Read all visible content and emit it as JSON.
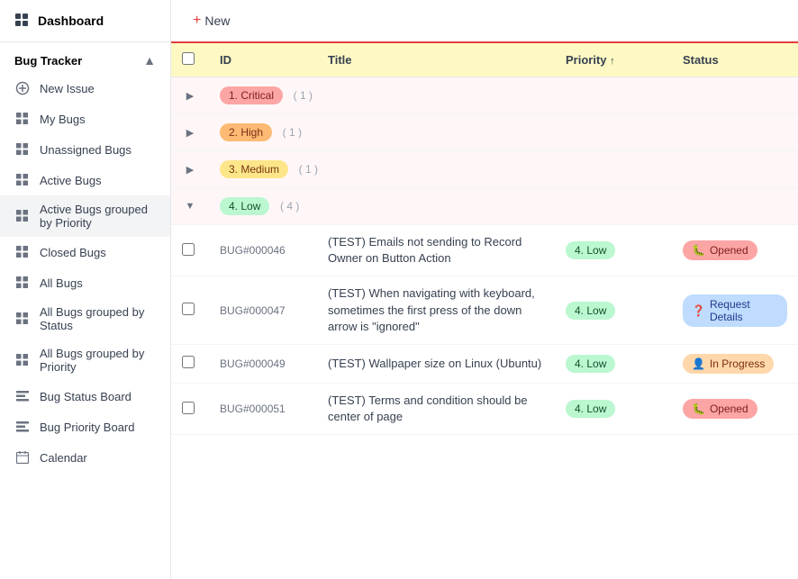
{
  "sidebar": {
    "dashboard_label": "Dashboard",
    "section_label": "Bug Tracker",
    "items": [
      {
        "id": "new-issue",
        "label": "New Issue",
        "icon": "circle-plus",
        "active": false
      },
      {
        "id": "my-bugs",
        "label": "My Bugs",
        "icon": "grid",
        "active": false
      },
      {
        "id": "unassigned-bugs",
        "label": "Unassigned Bugs",
        "icon": "grid",
        "active": false
      },
      {
        "id": "active-bugs",
        "label": "Active Bugs",
        "icon": "grid",
        "active": false
      },
      {
        "id": "active-bugs-grouped-priority",
        "label": "Active Bugs grouped by Priority",
        "icon": "grid",
        "active": true
      },
      {
        "id": "closed-bugs",
        "label": "Closed Bugs",
        "icon": "grid",
        "active": false
      },
      {
        "id": "all-bugs",
        "label": "All Bugs",
        "icon": "grid",
        "active": false
      },
      {
        "id": "all-bugs-grouped-status",
        "label": "All Bugs grouped by Status",
        "icon": "grid",
        "active": false
      },
      {
        "id": "all-bugs-grouped-priority",
        "label": "All Bugs grouped by Priority",
        "icon": "grid",
        "active": false
      },
      {
        "id": "bug-status-board",
        "label": "Bug Status Board",
        "icon": "bars",
        "active": false
      },
      {
        "id": "bug-priority-board",
        "label": "Bug Priority Board",
        "icon": "bars",
        "active": false
      },
      {
        "id": "calendar",
        "label": "Calendar",
        "icon": "cal",
        "active": false
      }
    ]
  },
  "toolbar": {
    "new_label": "New"
  },
  "table": {
    "columns": [
      "",
      "ID",
      "Title",
      "Priority ↑",
      "Status"
    ],
    "groups": [
      {
        "id": "critical",
        "priority_label": "1. Critical",
        "priority_class": "priority-critical",
        "count": "( 1 )",
        "expanded": false,
        "rows": []
      },
      {
        "id": "high",
        "priority_label": "2. High",
        "priority_class": "priority-high",
        "count": "( 1 )",
        "expanded": false,
        "rows": []
      },
      {
        "id": "medium",
        "priority_label": "3. Medium",
        "priority_class": "priority-medium",
        "count": "( 1 )",
        "expanded": false,
        "rows": []
      },
      {
        "id": "low",
        "priority_label": "4. Low",
        "priority_class": "priority-low",
        "count": "( 4 )",
        "expanded": true,
        "rows": [
          {
            "id": "BUG#000046",
            "title": "(TEST) Emails not sending to Record Owner on Button Action",
            "priority_label": "4. Low",
            "priority_class": "priority-low",
            "status_label": "Opened",
            "status_class": "status-opened",
            "status_icon": "🐛"
          },
          {
            "id": "BUG#000047",
            "title": "(TEST) When navigating with keyboard, sometimes the first press of the down arrow is \"ignored\"",
            "priority_label": "4. Low",
            "priority_class": "priority-low",
            "status_label": "Request Details",
            "status_class": "status-request",
            "status_icon": "❓"
          },
          {
            "id": "BUG#000049",
            "title": "(TEST) Wallpaper size on Linux (Ubuntu)",
            "priority_label": "4. Low",
            "priority_class": "priority-low",
            "status_label": "In Progress",
            "status_class": "status-inprogress",
            "status_icon": "👤"
          },
          {
            "id": "BUG#000051",
            "title": "(TEST) Terms and condition should be center of page",
            "priority_label": "4. Low",
            "priority_class": "priority-low",
            "status_label": "Opened",
            "status_class": "status-opened",
            "status_icon": "🐛"
          }
        ]
      }
    ]
  }
}
